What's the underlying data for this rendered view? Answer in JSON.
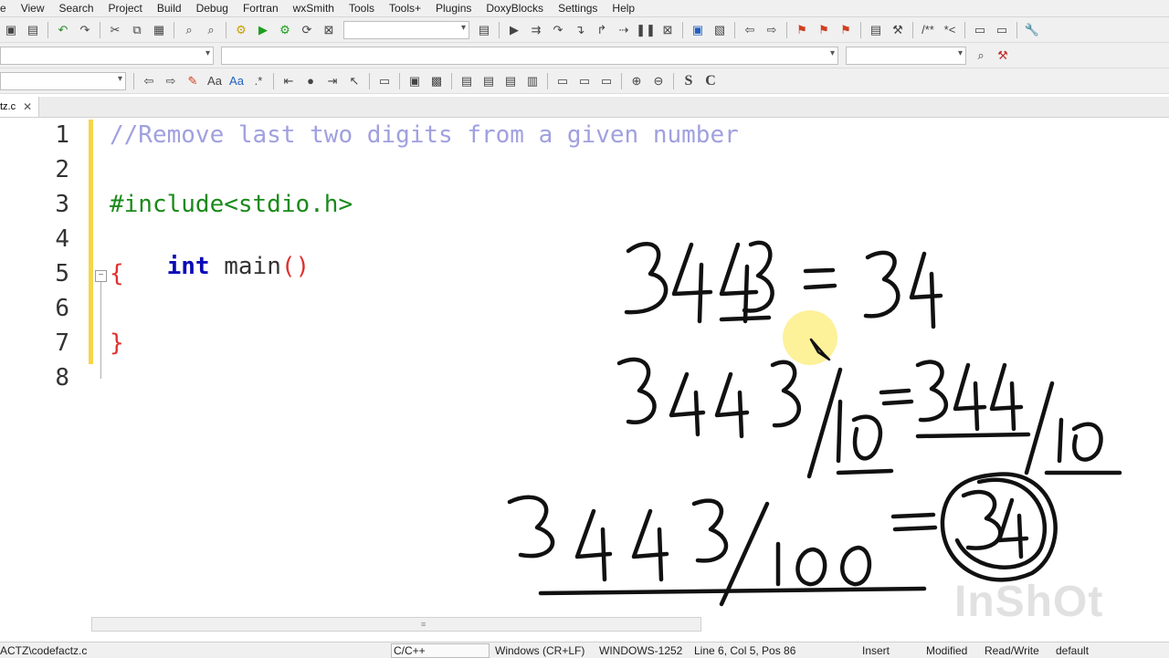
{
  "menu": [
    "View",
    "Search",
    "Project",
    "Build",
    "Debug",
    "Fortran",
    "wxSmith",
    "Tools",
    "Tools+",
    "Plugins",
    "DoxyBlocks",
    "Settings",
    "Help"
  ],
  "menu_partial_first": "e",
  "tab": {
    "label": "tz.c",
    "close": "✕"
  },
  "lines": {
    "n1": "1",
    "n2": "2",
    "n3": "3",
    "n4": "4",
    "n5": "5",
    "n6": "6",
    "n7": "7",
    "n8": "8"
  },
  "code": {
    "l1": "//Remove last two digits from a given number",
    "l3": "#include<stdio.h>",
    "l4_kw": "int",
    "l4_rest": " main",
    "l4_paren": "()",
    "l5": "{",
    "l7": "}"
  },
  "status": {
    "path": "ACTZ\\codefactz.c",
    "lang": "C/C++",
    "eol": "Windows (CR+LF)",
    "enc": "WINDOWS-1252",
    "pos": "Line 6, Col 5, Pos 86",
    "mode": "Insert",
    "modified": "Modified",
    "rw": "Read/Write",
    "profile": "default"
  },
  "watermark": "InShOt",
  "colors": {
    "accent": "#0a0ab8",
    "comment": "#a0a0e0",
    "preprocessor": "#1a8a1a",
    "brace": "#e03030",
    "changebar": "#f7d54a"
  }
}
